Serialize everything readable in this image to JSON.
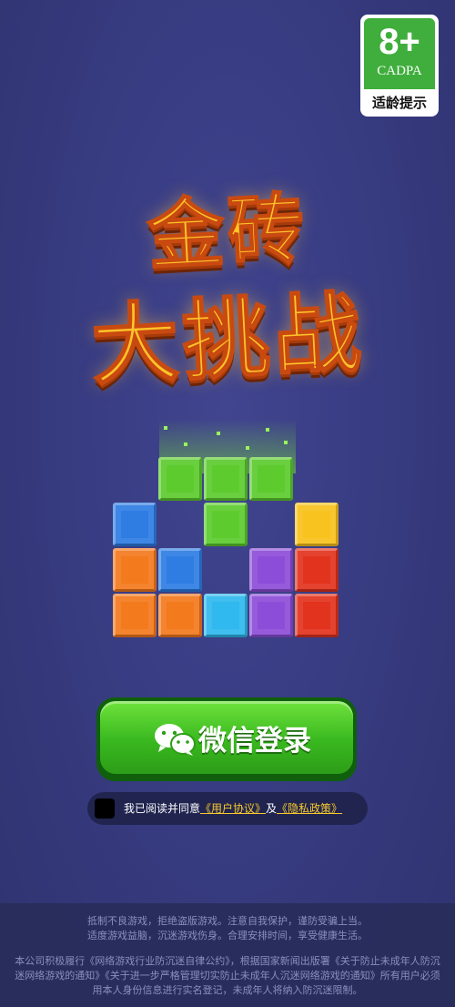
{
  "age_badge": {
    "age": "8+",
    "org": "CADPA",
    "hint": "适龄提示"
  },
  "logo": {
    "line1": "金砖",
    "line2": "大挑战"
  },
  "login": {
    "button_label": "微信登录"
  },
  "agreement": {
    "prefix": "我已阅读并同意",
    "user_agreement": "《用户协议》",
    "and": "及",
    "privacy_policy": "《隐私政策》"
  },
  "notice": {
    "line1": "抵制不良游戏，拒绝盗版游戏。注意自我保护，谨防受骗上当。",
    "line2": "适度游戏益脑，沉迷游戏伤身。合理安排时间，享受健康生活。",
    "line3": "本公司积极履行《网络游戏行业防沉迷自律公约》，根据国家新闻出版署《关于防止未成年人防沉迷网络游戏的通知》《关于进一步严格管理切实防止未成年人沉迷网络游戏的通知》所有用户必须用本人身份信息进行实名登记，未成年人将纳入防沉迷限制。"
  },
  "colors": {
    "green": "#5dcb2e",
    "blue": "#2f7de3",
    "orange": "#f47a1e",
    "yellow": "#f8c31e",
    "purple": "#8c4ed8",
    "red": "#e2331e",
    "cyan": "#2fb9ee"
  },
  "blocks": [
    {
      "row": 0,
      "col": 1,
      "color": "green"
    },
    {
      "row": 0,
      "col": 2,
      "color": "green"
    },
    {
      "row": 0,
      "col": 3,
      "color": "green"
    },
    {
      "row": 1,
      "col": 0,
      "color": "blue"
    },
    {
      "row": 1,
      "col": 2,
      "color": "green"
    },
    {
      "row": 1,
      "col": 4,
      "color": "yellow"
    },
    {
      "row": 2,
      "col": 0,
      "color": "orange"
    },
    {
      "row": 2,
      "col": 1,
      "color": "blue"
    },
    {
      "row": 2,
      "col": 3,
      "color": "purple"
    },
    {
      "row": 2,
      "col": 4,
      "color": "red"
    },
    {
      "row": 3,
      "col": 0,
      "color": "orange"
    },
    {
      "row": 3,
      "col": 1,
      "color": "orange"
    },
    {
      "row": 3,
      "col": 2,
      "color": "cyan"
    },
    {
      "row": 3,
      "col": 3,
      "color": "purple"
    },
    {
      "row": 3,
      "col": 4,
      "color": "red"
    }
  ]
}
